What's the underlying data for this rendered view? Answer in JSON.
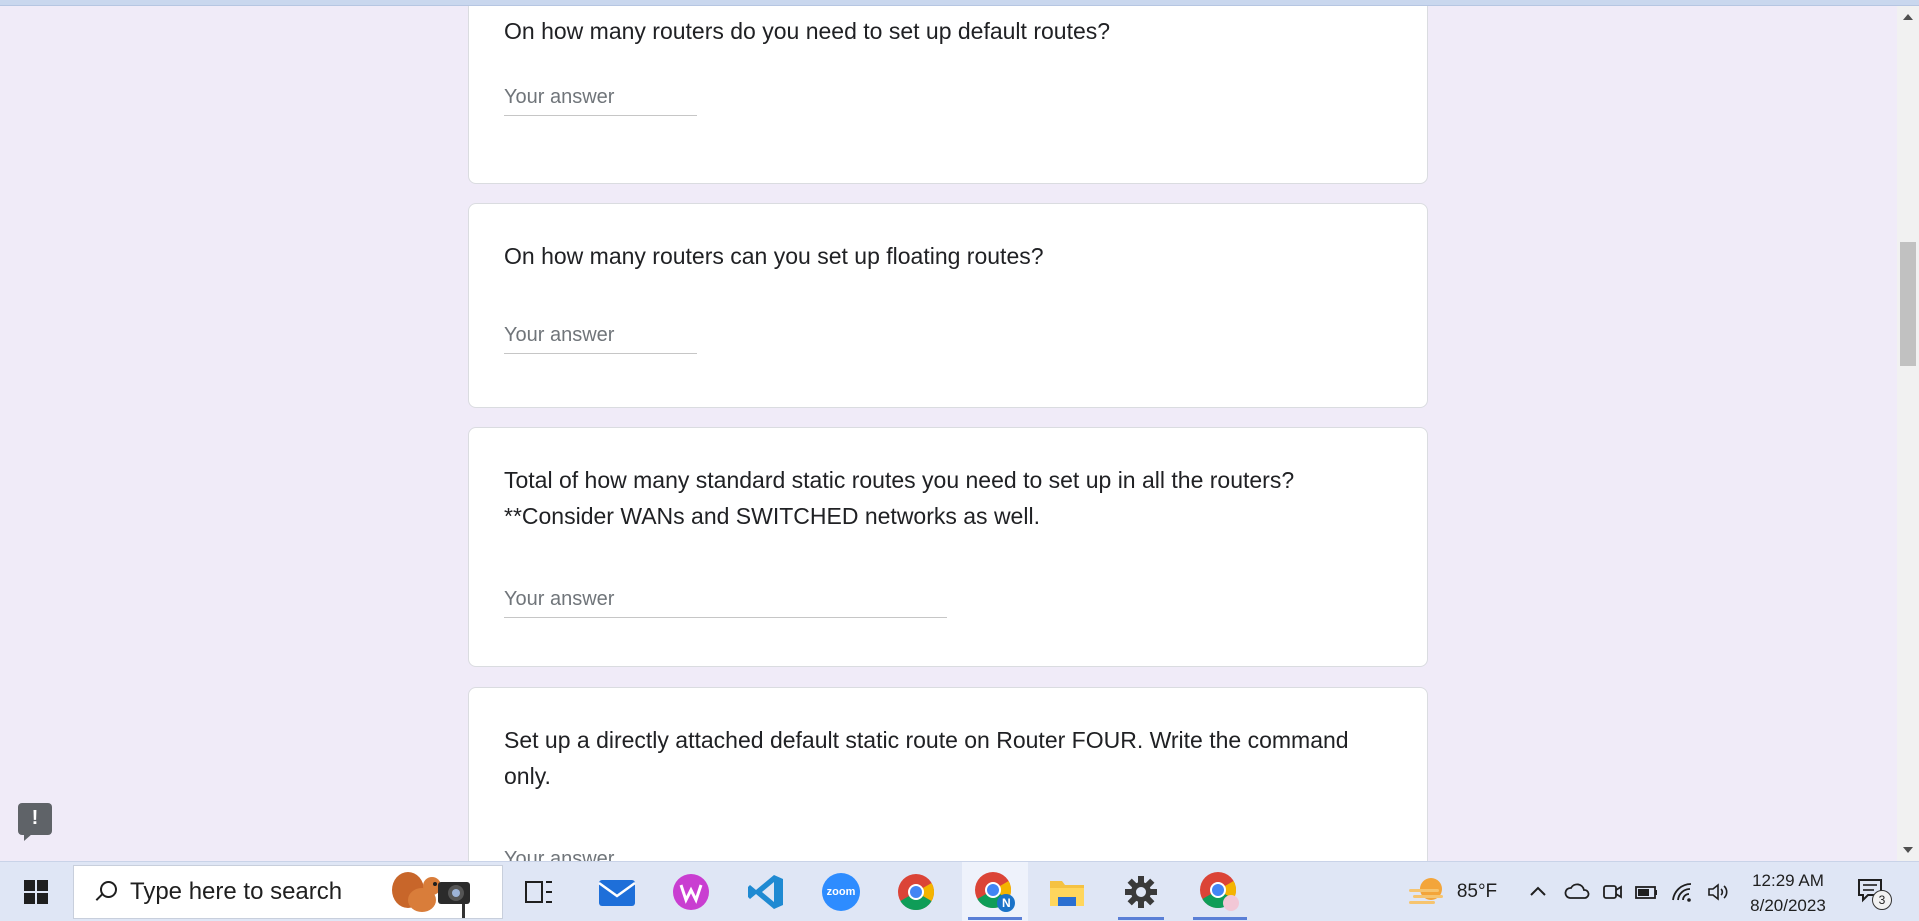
{
  "form": {
    "questions": [
      {
        "text": "On how many routers do you need to set up default routes?",
        "placeholder": "Your answer"
      },
      {
        "text": "On how many routers can you set up floating routes?",
        "placeholder": "Your answer"
      },
      {
        "text": "Total of how many standard static routes you need to set up in all the routers? **Consider WANs and SWITCHED networks as well.",
        "placeholder": "Your answer"
      },
      {
        "text": "Set up a directly attached default static route on Router FOUR. Write the command only.",
        "placeholder": "Your answer"
      }
    ],
    "feedback_glyph": "!"
  },
  "taskbar": {
    "search_placeholder": "Type here to search",
    "apps": [
      "task-view",
      "mail",
      "wps-office",
      "vscode",
      "zoom",
      "chrome",
      "chrome-profile-n",
      "file-explorer",
      "settings",
      "chrome-profile-2"
    ],
    "zoom_label": "zoom",
    "chrome_profile_badge": "N",
    "weather_temp": "85°F",
    "time": "12:29 AM",
    "date": "8/20/2023",
    "notification_count": "3"
  },
  "colors": {
    "background": "#f0ebf8",
    "card": "#ffffff",
    "taskbar": "#dfe6f5",
    "accent": "#5a7fd6"
  }
}
